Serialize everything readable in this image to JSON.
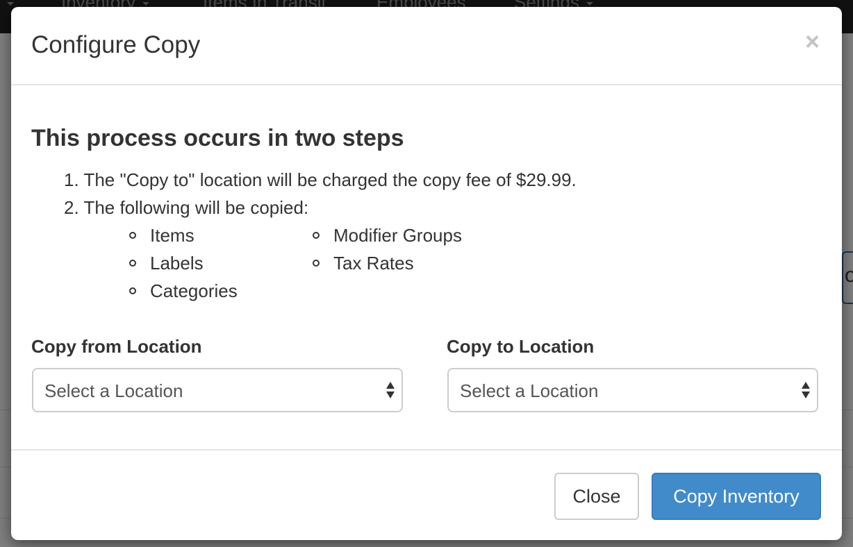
{
  "background": {
    "nav_items": [
      "Inventory",
      "Items In Transit",
      "Employees",
      "Settings"
    ],
    "edge_button_text": "or"
  },
  "modal": {
    "title": "Configure Copy",
    "close_symbol": "×",
    "heading": "This process occurs in two steps",
    "steps": [
      "1. The \"Copy to\" location will be charged the copy fee of $29.99.",
      "2. The following will be copied:"
    ],
    "copied_items": {
      "column_1": [
        "Items",
        "Labels",
        "Categories"
      ],
      "column_2": [
        "Modifier Groups",
        "Tax Rates"
      ]
    },
    "copy_from": {
      "label": "Copy from Location",
      "selected": "Select a Location"
    },
    "copy_to": {
      "label": "Copy to Location",
      "selected": "Select a Location"
    },
    "footer": {
      "close_label": "Close",
      "copy_label": "Copy Inventory"
    }
  },
  "colors": {
    "primary": "#428bca",
    "navbar": "#222222",
    "backdrop": "rgba(0,0,0,0.5)"
  },
  "icons": {
    "close": "close-icon",
    "select_arrows": "select-arrows-icon",
    "nav_caret": "caret-down-icon"
  }
}
